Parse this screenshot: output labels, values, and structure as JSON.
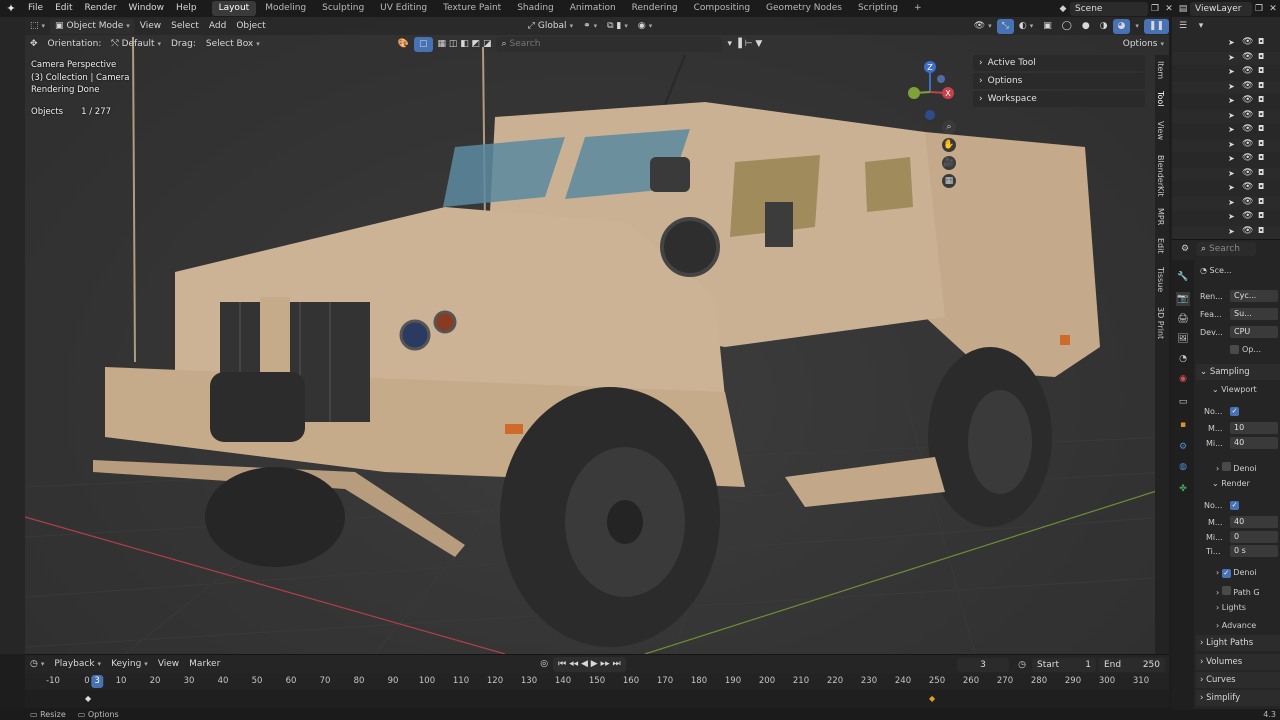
{
  "menus": {
    "file": "File",
    "edit": "Edit",
    "render": "Render",
    "window": "Window",
    "help": "Help"
  },
  "workspaces": [
    "Layout",
    "Modeling",
    "Sculpting",
    "UV Editing",
    "Texture Paint",
    "Shading",
    "Animation",
    "Rendering",
    "Compositing",
    "Geometry Nodes",
    "Scripting"
  ],
  "workspace_add": "+",
  "scene_name": "Scene",
  "view_layer": "ViewLayer",
  "viewport_header": {
    "mode": "Object Mode",
    "view": "View",
    "select": "Select",
    "add": "Add",
    "object": "Object",
    "transform": "Global"
  },
  "tool_header": {
    "orientation_label": "Orientation:",
    "orientation_value": "Default",
    "drag_label": "Drag:",
    "drag_value": "Select Box",
    "search_placeholder": "Search",
    "options": "Options"
  },
  "overlay": {
    "line1": "Camera Perspective",
    "line2": "(3) Collection | Camera",
    "line3": "Rendering Done",
    "objects_label": "Objects",
    "objects_value": "1 / 277"
  },
  "n_panel": {
    "active_tool": "Active Tool",
    "options": "Options",
    "workspace": "Workspace",
    "tabs": [
      "Item",
      "Tool",
      "View",
      "BlenderKit",
      "MPR",
      "Edit",
      "Tissue",
      "3D Print"
    ]
  },
  "gizmo": {
    "z": "Z",
    "x": "X",
    "y": "Y"
  },
  "timeline": {
    "playback": "Playback",
    "keying": "Keying",
    "view": "View",
    "marker": "Marker",
    "current_frame": "3",
    "start_label": "Start",
    "start_value": "1",
    "end_label": "End",
    "end_value": "250",
    "playhead": "3",
    "ticks": [
      "-10",
      "0",
      "10",
      "20",
      "30",
      "40",
      "50",
      "60",
      "70",
      "80",
      "90",
      "100",
      "110",
      "120",
      "130",
      "140",
      "150",
      "160",
      "170",
      "180",
      "190",
      "200",
      "210",
      "220",
      "230",
      "240",
      "250",
      "260",
      "270",
      "280",
      "290",
      "300",
      "310"
    ]
  },
  "status": {
    "resize": "Resize",
    "options": "Options",
    "version": "4.3"
  },
  "properties": {
    "scene": "Sce...",
    "search": "Search",
    "render_engine_label": "Ren...",
    "render_engine_value": "Cyc...",
    "feature_label": "Fea...",
    "feature_value": "Su...",
    "device_label": "Dev...",
    "device_value": "CPU",
    "open_label": "Op...",
    "sampling": "Sampling",
    "viewport": "Viewport",
    "noise_label": "No...",
    "max_label": "M...",
    "max_value": "10",
    "min_label": "Mi...",
    "min_value": "40",
    "denoise": "Denoi",
    "render": "Render",
    "noise2_label": "No...",
    "max2_label": "M...",
    "max2_value": "40",
    "min2_label": "Mi...",
    "min2_value": "0",
    "time_label": "Ti...",
    "time_value": "0 s",
    "denoise2": "Denoi",
    "path_guiding": "Path G",
    "lights": "Lights",
    "advanced": "Advance",
    "light_paths": "Light Paths",
    "volumes": "Volumes",
    "curves": "Curves",
    "simplify": "Simplify"
  },
  "colors": {
    "accent": "#4772b3",
    "vehicle_tan": "#c9ae8e",
    "x_axis": "#c8404a",
    "y_axis": "#7ea23a",
    "z_axis": "#3e6ec9"
  }
}
